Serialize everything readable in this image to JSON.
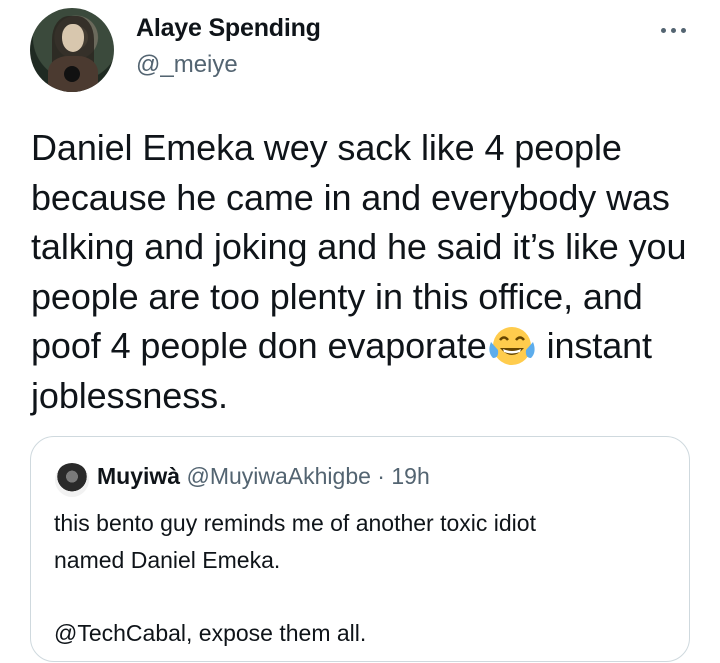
{
  "author": {
    "display_name": "Alaye Spending",
    "handle": "@_meiye",
    "avatar_icon": "profile-photo-avatar"
  },
  "menu": {
    "icon": "more-horizontal-icon"
  },
  "tweet": {
    "text_part1": "Daniel Emeka wey sack like 4 people because he came in and everybody was talking and joking and he said it’s like you people are too plenty in this office, and poof 4 people don evaporate",
    "emoji": "😂",
    "emoji_name": "face-with-tears-of-joy-icon",
    "text_part2": " instant joblessness."
  },
  "quote": {
    "display_name": "Muyiwà",
    "handle": "@MuyiwaAkhigbe",
    "separator": "·",
    "time": "19h",
    "line1": "this bento guy reminds me of another toxic idiot",
    "line2": "named Daniel Emeka.",
    "line3": "",
    "line4": "@TechCabal, expose them all."
  },
  "colors": {
    "text": "#0f1419",
    "secondary": "#536471",
    "border": "#cfd9de"
  }
}
